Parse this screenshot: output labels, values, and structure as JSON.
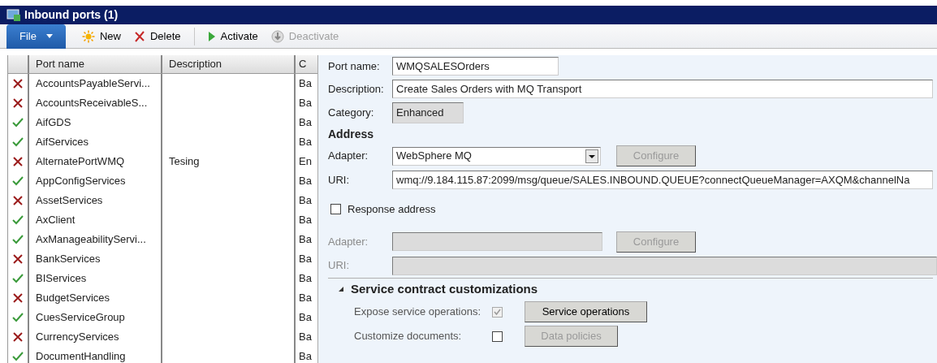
{
  "window": {
    "title": "Inbound ports (1)"
  },
  "toolbar": [
    {
      "kind": "file",
      "label": "File",
      "disabled": false
    },
    {
      "kind": "new",
      "label": "New",
      "disabled": false
    },
    {
      "kind": "delete",
      "label": "Delete",
      "disabled": false
    },
    {
      "kind": "activate",
      "label": "Activate",
      "disabled": false
    },
    {
      "kind": "deactivate",
      "label": "Deactivate",
      "disabled": true
    }
  ],
  "grid": {
    "columns": [
      "Port name",
      "Description",
      "C"
    ],
    "rows": [
      {
        "active": false,
        "port_name": "AccountsPayableServi...",
        "description": "",
        "column_3": "Ba"
      },
      {
        "active": false,
        "port_name": "AccountsReceivableS...",
        "description": "",
        "column_3": "Ba"
      },
      {
        "active": true,
        "port_name": "AifGDS",
        "description": "",
        "column_3": "Ba"
      },
      {
        "active": true,
        "port_name": "AifServices",
        "description": "",
        "column_3": "Ba"
      },
      {
        "active": false,
        "port_name": "AlternatePortWMQ",
        "description": "Tesing",
        "column_3": "En"
      },
      {
        "active": true,
        "port_name": "AppConfigServices",
        "description": "",
        "column_3": "Ba"
      },
      {
        "active": false,
        "port_name": "AssetServices",
        "description": "",
        "column_3": "Ba"
      },
      {
        "active": true,
        "port_name": "AxClient",
        "description": "",
        "column_3": "Ba"
      },
      {
        "active": true,
        "port_name": "AxManageabilityServi...",
        "description": "",
        "column_3": "Ba"
      },
      {
        "active": false,
        "port_name": "BankServices",
        "description": "",
        "column_3": "Ba"
      },
      {
        "active": true,
        "port_name": "BIServices",
        "description": "",
        "column_3": "Ba"
      },
      {
        "active": false,
        "port_name": "BudgetServices",
        "description": "",
        "column_3": "Ba"
      },
      {
        "active": true,
        "port_name": "CuesServiceGroup",
        "description": "",
        "column_3": "Ba"
      },
      {
        "active": false,
        "port_name": "CurrencyServices",
        "description": "",
        "column_3": "Ba"
      },
      {
        "active": true,
        "port_name": "DocumentHandling",
        "description": "",
        "column_3": "Ba"
      }
    ]
  },
  "details": {
    "port_name": {
      "label": "Port name:",
      "value": "WMQSALESOrders"
    },
    "description": {
      "label": "Description:",
      "value": "Create Sales Orders with MQ Transport"
    },
    "category": {
      "label": "Category:",
      "value": "Enhanced"
    },
    "address": {
      "heading": "Address",
      "adapter": {
        "label": "Adapter:",
        "value": "WebSphere MQ",
        "configure": "Configure"
      },
      "uri": {
        "label": "URI:",
        "value": "wmq://9.184.115.87:2099/msg/queue/SALES.INBOUND.QUEUE?connectQueueManager=AXQM&channelNa"
      }
    },
    "response_address": {
      "label": "Response address",
      "checked": false,
      "adapter": {
        "label": "Adapter:",
        "configure": "Configure"
      },
      "uri": {
        "label": "URI:"
      }
    },
    "service_contract": {
      "heading": "Service contract customizations",
      "expanded": true,
      "expose": {
        "label": "Expose service operations:",
        "checked": true,
        "button": "Service operations"
      },
      "customize": {
        "label": "Customize documents:",
        "checked": false,
        "button": "Data policies"
      }
    }
  }
}
